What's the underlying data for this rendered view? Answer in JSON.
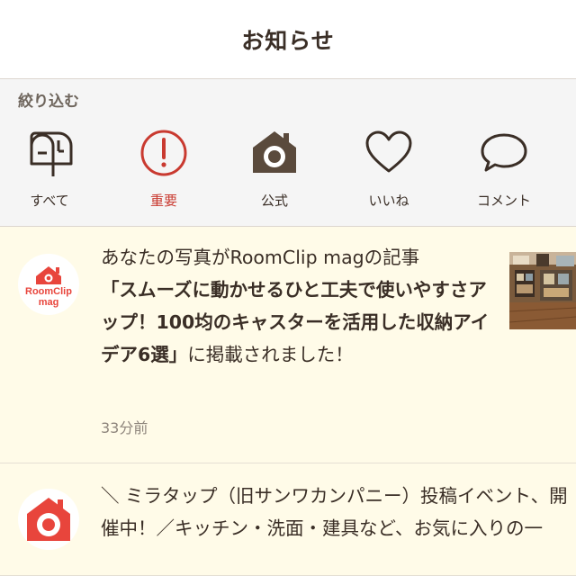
{
  "header": {
    "title": "お知らせ"
  },
  "filter": {
    "label": "絞り込む",
    "items": [
      {
        "label": "すべて",
        "icon": "mailbox-icon",
        "active": false
      },
      {
        "label": "重要",
        "icon": "exclamation-circle-icon",
        "active": true
      },
      {
        "label": "公式",
        "icon": "house-camera-icon",
        "active": false
      },
      {
        "label": "いいね",
        "icon": "heart-icon",
        "active": false
      },
      {
        "label": "コメント",
        "icon": "speech-bubble-icon",
        "active": false
      }
    ]
  },
  "colors": {
    "accent_red": "#c93a30",
    "brand_red": "#e8453c",
    "text_brown": "#3a2e26",
    "notice_bg": "#fffbe8"
  },
  "notifications": [
    {
      "avatar": {
        "logo_line1": "RoomClip",
        "logo_line2": "mag"
      },
      "text_before": "あなたの写真がRoomClip magの記事",
      "text_bold": "「スムーズに動かせるひと工夫で使いやすさアップ！100均のキャスターを活用した収納アイデア6選」",
      "text_after": "に掲載されました！",
      "time": "33分前",
      "thumbnail": "room-photo"
    },
    {
      "avatar": {
        "icon": "house-camera-icon"
      },
      "text": "＼ ミラタップ（旧サンワカンパニー）投稿イベント、開催中！／キッチン・洗面・建具など、お気に入りの一"
    }
  ]
}
